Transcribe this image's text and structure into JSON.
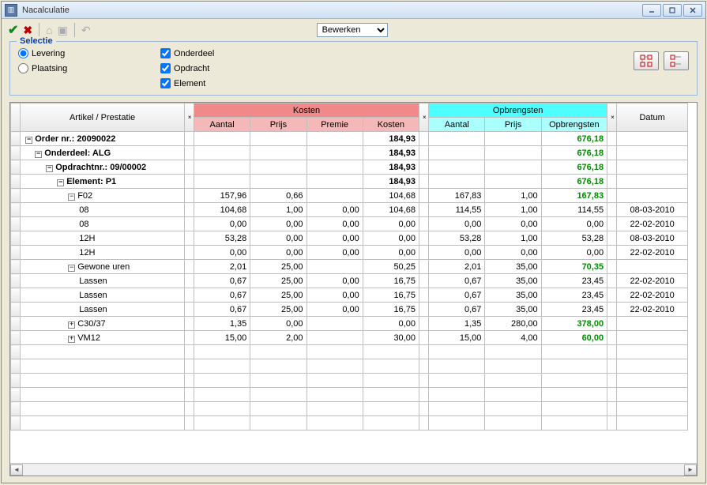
{
  "window": {
    "title": "Nacalculatie"
  },
  "toolbar": {
    "mode_value": "Bewerken"
  },
  "selectie": {
    "legend": "Selectie",
    "radio_levering": "Levering",
    "radio_plaatsing": "Plaatsing",
    "check_onderdeel": "Onderdeel",
    "check_opdracht": "Opdracht",
    "check_element": "Element"
  },
  "headers": {
    "artikel": "Artikel / Prestatie",
    "kosten": "Kosten",
    "opbrengsten": "Opbrengsten",
    "datum": "Datum",
    "k_aantal": "Aantal",
    "k_prijs": "Prijs",
    "k_premie": "Premie",
    "k_kosten": "Kosten",
    "o_aantal": "Aantal",
    "o_prijs": "Prijs",
    "o_opbr": "Opbrengsten"
  },
  "rows": [
    {
      "label": "Order nr.: 20090022",
      "indent": 0,
      "toggle": "-",
      "bold": true,
      "k_aantal": "",
      "k_prijs": "",
      "k_premie": "",
      "k_kosten": "184,93",
      "o_aantal": "",
      "o_prijs": "",
      "o_opbr": "676,18",
      "opbr_green": true,
      "datum": ""
    },
    {
      "label": "Onderdeel: ALG",
      "indent": 1,
      "toggle": "-",
      "bold": true,
      "k_aantal": "",
      "k_prijs": "",
      "k_premie": "",
      "k_kosten": "184,93",
      "o_aantal": "",
      "o_prijs": "",
      "o_opbr": "676,18",
      "opbr_green": true,
      "datum": ""
    },
    {
      "label": "Opdrachtnr.: 09/00002",
      "indent": 2,
      "toggle": "-",
      "bold": true,
      "k_aantal": "",
      "k_prijs": "",
      "k_premie": "",
      "k_kosten": "184,93",
      "o_aantal": "",
      "o_prijs": "",
      "o_opbr": "676,18",
      "opbr_green": true,
      "datum": ""
    },
    {
      "label": "Element: P1",
      "indent": 3,
      "toggle": "-",
      "bold": true,
      "k_aantal": "",
      "k_prijs": "",
      "k_premie": "",
      "k_kosten": "184,93",
      "o_aantal": "",
      "o_prijs": "",
      "o_opbr": "676,18",
      "opbr_green": true,
      "datum": ""
    },
    {
      "label": "F02",
      "indent": 4,
      "toggle": "-",
      "bold": false,
      "k_aantal": "157,96",
      "k_prijs": "0,66",
      "k_premie": "",
      "k_kosten": "104,68",
      "o_aantal": "167,83",
      "o_prijs": "1,00",
      "o_opbr": "167,83",
      "opbr_green": true,
      "datum": ""
    },
    {
      "label": "08",
      "indent": 5,
      "toggle": "",
      "bold": false,
      "k_aantal": "104,68",
      "k_prijs": "1,00",
      "k_premie": "0,00",
      "k_kosten": "104,68",
      "o_aantal": "114,55",
      "o_prijs": "1,00",
      "o_opbr": "114,55",
      "opbr_green": false,
      "datum": "08-03-2010"
    },
    {
      "label": "08",
      "indent": 5,
      "toggle": "",
      "bold": false,
      "k_aantal": "0,00",
      "k_prijs": "0,00",
      "k_premie": "0,00",
      "k_kosten": "0,00",
      "o_aantal": "0,00",
      "o_prijs": "0,00",
      "o_opbr": "0,00",
      "opbr_green": false,
      "datum": "22-02-2010"
    },
    {
      "label": "12H",
      "indent": 5,
      "toggle": "",
      "bold": false,
      "k_aantal": "53,28",
      "k_prijs": "0,00",
      "k_premie": "0,00",
      "k_kosten": "0,00",
      "o_aantal": "53,28",
      "o_prijs": "1,00",
      "o_opbr": "53,28",
      "opbr_green": false,
      "datum": "08-03-2010"
    },
    {
      "label": "12H",
      "indent": 5,
      "toggle": "",
      "bold": false,
      "k_aantal": "0,00",
      "k_prijs": "0,00",
      "k_premie": "0,00",
      "k_kosten": "0,00",
      "o_aantal": "0,00",
      "o_prijs": "0,00",
      "o_opbr": "0,00",
      "opbr_green": false,
      "datum": "22-02-2010"
    },
    {
      "label": "Gewone uren",
      "indent": 4,
      "toggle": "-",
      "bold": false,
      "k_aantal": "2,01",
      "k_prijs": "25,00",
      "k_premie": "",
      "k_kosten": "50,25",
      "o_aantal": "2,01",
      "o_prijs": "35,00",
      "o_opbr": "70,35",
      "opbr_green": true,
      "datum": ""
    },
    {
      "label": "Lassen",
      "indent": 5,
      "toggle": "",
      "bold": false,
      "k_aantal": "0,67",
      "k_prijs": "25,00",
      "k_premie": "0,00",
      "k_kosten": "16,75",
      "o_aantal": "0,67",
      "o_prijs": "35,00",
      "o_opbr": "23,45",
      "opbr_green": false,
      "datum": "22-02-2010"
    },
    {
      "label": "Lassen",
      "indent": 5,
      "toggle": "",
      "bold": false,
      "k_aantal": "0,67",
      "k_prijs": "25,00",
      "k_premie": "0,00",
      "k_kosten": "16,75",
      "o_aantal": "0,67",
      "o_prijs": "35,00",
      "o_opbr": "23,45",
      "opbr_green": false,
      "datum": "22-02-2010"
    },
    {
      "label": "Lassen",
      "indent": 5,
      "toggle": "",
      "bold": false,
      "k_aantal": "0,67",
      "k_prijs": "25,00",
      "k_premie": "0,00",
      "k_kosten": "16,75",
      "o_aantal": "0,67",
      "o_prijs": "35,00",
      "o_opbr": "23,45",
      "opbr_green": false,
      "datum": "22-02-2010"
    },
    {
      "label": "C30/37",
      "indent": 4,
      "toggle": "+",
      "bold": false,
      "k_aantal": "1,35",
      "k_prijs": "0,00",
      "k_premie": "",
      "k_kosten": "0,00",
      "o_aantal": "1,35",
      "o_prijs": "280,00",
      "o_opbr": "378,00",
      "opbr_green": true,
      "datum": ""
    },
    {
      "label": "VM12",
      "indent": 4,
      "toggle": "+",
      "bold": false,
      "k_aantal": "15,00",
      "k_prijs": "2,00",
      "k_premie": "",
      "k_kosten": "30,00",
      "o_aantal": "15,00",
      "o_prijs": "4,00",
      "o_opbr": "60,00",
      "opbr_green": true,
      "datum": ""
    }
  ]
}
